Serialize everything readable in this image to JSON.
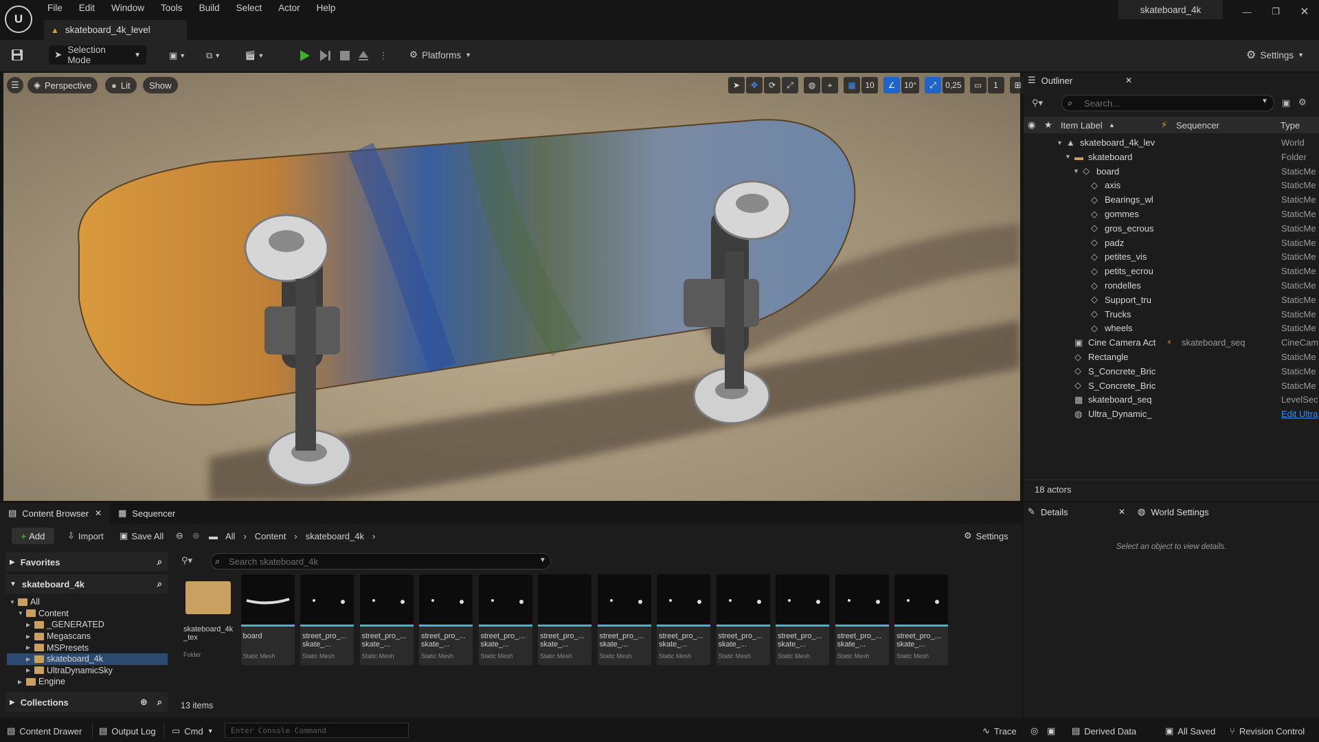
{
  "app": {
    "logo": "U",
    "menu": [
      "File",
      "Edit",
      "Window",
      "Tools",
      "Build",
      "Select",
      "Actor",
      "Help"
    ],
    "level_tab": "skateboard_4k_level",
    "project_name": "skateboard_4k"
  },
  "toolbar": {
    "selection_mode": "Selection Mode",
    "platforms": "Platforms",
    "settings": "Settings"
  },
  "viewport": {
    "perspective": "Perspective",
    "lit": "Lit",
    "show": "Show",
    "grid_snap": "10",
    "rotation_snap": "10°",
    "scale_snap": "0,25",
    "camera_speed": "1"
  },
  "outliner": {
    "tab": "Outliner",
    "search_placeholder": "Search...",
    "col_label": "Item Label",
    "col_sequencer": "Sequencer",
    "col_type": "Type",
    "rows": [
      {
        "label": "skateboard_4k_lev",
        "type": "World"
      },
      {
        "label": "skateboard",
        "type": "Folder"
      },
      {
        "label": "board",
        "type": "StaticMe"
      },
      {
        "label": "axis",
        "type": "StaticMe"
      },
      {
        "label": "Bearings_wl",
        "type": "StaticMe"
      },
      {
        "label": "gommes",
        "type": "StaticMe"
      },
      {
        "label": "gros_ecrous",
        "type": "StaticMe"
      },
      {
        "label": "padz",
        "type": "StaticMe"
      },
      {
        "label": "petites_vis",
        "type": "StaticMe"
      },
      {
        "label": "petits_ecrou",
        "type": "StaticMe"
      },
      {
        "label": "rondelles",
        "type": "StaticMe"
      },
      {
        "label": "Support_tru",
        "type": "StaticMe"
      },
      {
        "label": "Trucks",
        "type": "StaticMe"
      },
      {
        "label": "wheels",
        "type": "StaticMe"
      },
      {
        "label": "Cine Camera Act",
        "type": "CineCam",
        "sequencer": "skateboard_seq"
      },
      {
        "label": "Rectangle",
        "type": "StaticMe"
      },
      {
        "label": "S_Concrete_Bric",
        "type": "StaticMe"
      },
      {
        "label": "S_Concrete_Bric",
        "type": "StaticMe"
      },
      {
        "label": "skateboard_seq",
        "type": "LevelSec"
      },
      {
        "label": "Ultra_Dynamic_",
        "type": "Edit Ultra"
      }
    ],
    "footer": "18 actors"
  },
  "content_browser": {
    "tab": "Content Browser",
    "sequencer_tab": "Sequencer",
    "add": "Add",
    "import": "Import",
    "save_all": "Save All",
    "breadcrumb": [
      "All",
      "Content",
      "skateboard_4k"
    ],
    "settings": "Settings",
    "favorites": "Favorites",
    "project_section": "skateboard_4k",
    "tree": [
      {
        "label": "All",
        "depth": 0
      },
      {
        "label": "Content",
        "depth": 1
      },
      {
        "label": "_GENERATED",
        "depth": 2
      },
      {
        "label": "Megascans",
        "depth": 2
      },
      {
        "label": "MSPresets",
        "depth": 2
      },
      {
        "label": "skateboard_4k",
        "depth": 2
      },
      {
        "label": "UltraDynamicSky",
        "depth": 2
      },
      {
        "label": "Engine",
        "depth": 1
      }
    ],
    "collections": "Collections",
    "search_placeholder": "Search skateboard_4k",
    "assets": [
      {
        "name": "skateboard_4k _tex",
        "type": "Folder"
      },
      {
        "name": "board",
        "type": "Static Mesh"
      },
      {
        "name": "street_pro_... skate_...",
        "type": "Static Mesh"
      },
      {
        "name": "street_pro_... skate_...",
        "type": "Static Mesh"
      },
      {
        "name": "street_pro_... skate_...",
        "type": "Static Mesh"
      },
      {
        "name": "street_pro_... skate_...",
        "type": "Static Mesh"
      },
      {
        "name": "street_pro_... skate_...",
        "type": "Static Mesh"
      },
      {
        "name": "street_pro_... skate_...",
        "type": "Static Mesh"
      },
      {
        "name": "street_pro_... skate_...",
        "type": "Static Mesh"
      },
      {
        "name": "street_pro_... skate_...",
        "type": "Static Mesh"
      },
      {
        "name": "street_pro_... skate_...",
        "type": "Static Mesh"
      },
      {
        "name": "street_pro_... skate_...",
        "type": "Static Mesh"
      },
      {
        "name": "street_pro_... skate_...",
        "type": "Static Mesh"
      }
    ],
    "items_count": "13 items"
  },
  "details": {
    "tab": "Details",
    "world_settings": "World Settings",
    "hint": "Select an object to view details."
  },
  "statusbar": {
    "content_drawer": "Content Drawer",
    "output_log": "Output Log",
    "cmd": "Cmd",
    "console_placeholder": "Enter Console Command",
    "trace": "Trace",
    "derived_data": "Derived Data",
    "all_saved": "All Saved",
    "revision_control": "Revision Control"
  },
  "colors": {
    "accent": "#3a8cf0",
    "selection": "#2c4a72",
    "asset_underline": "#3fb8d8",
    "play_green": "#3fae2a",
    "folder": "#c9a062"
  }
}
